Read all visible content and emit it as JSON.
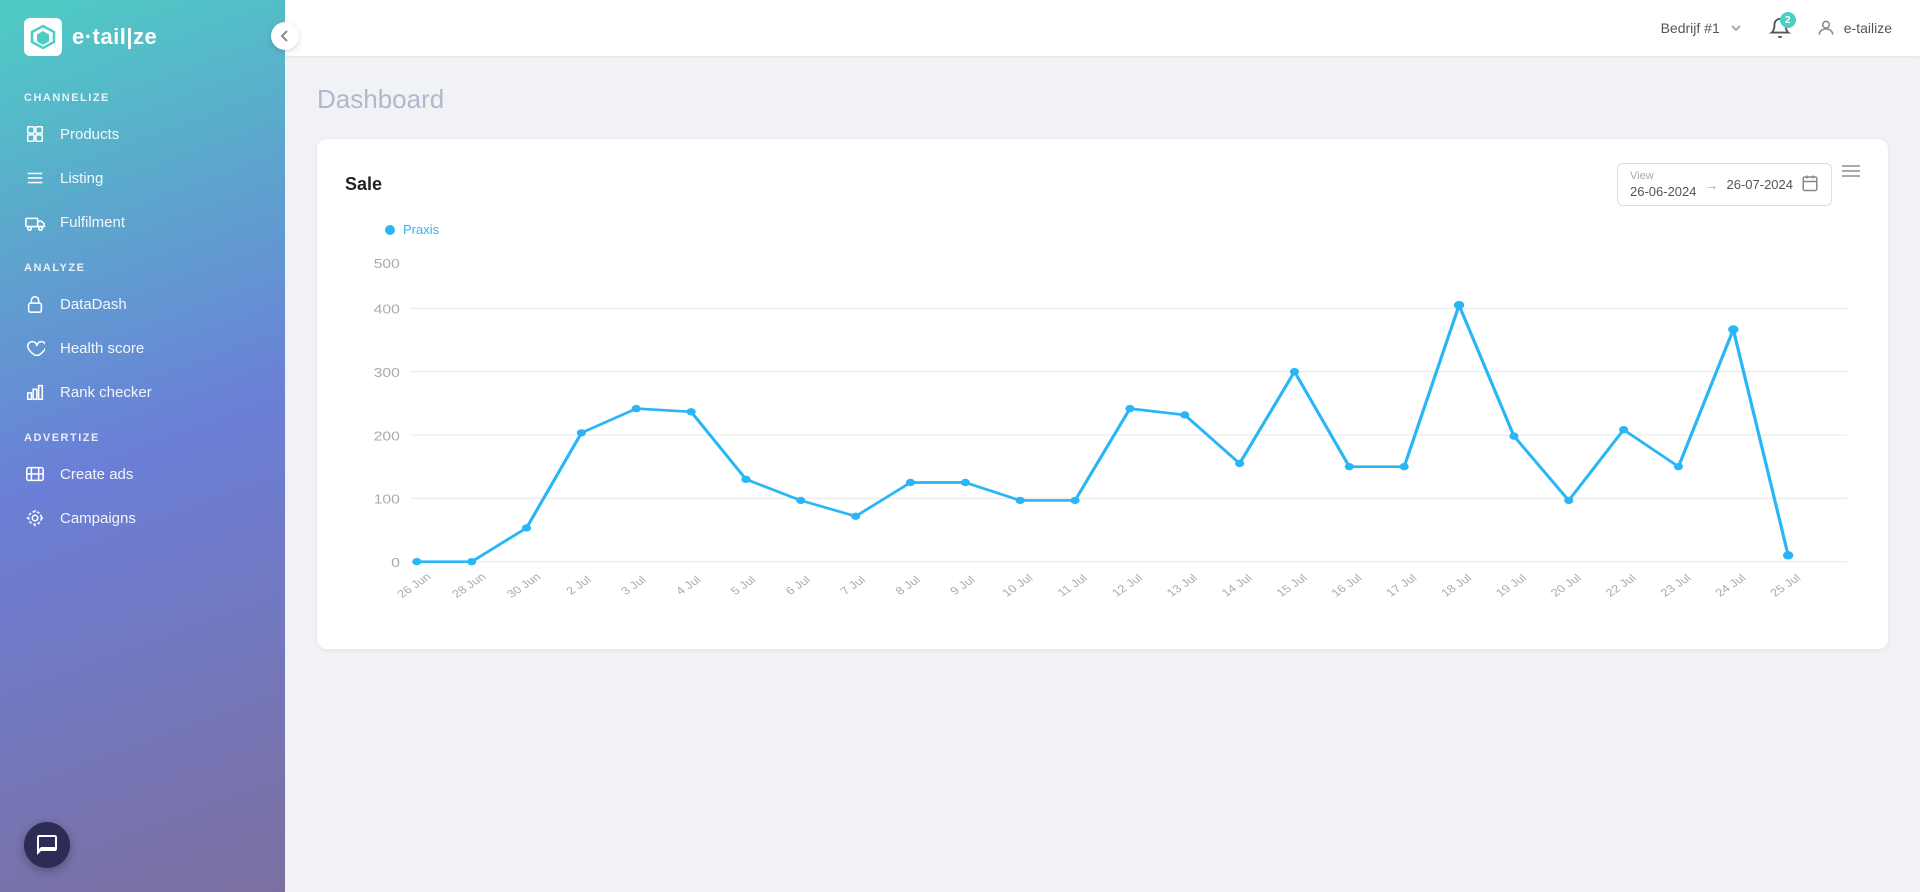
{
  "sidebar": {
    "logo_text": "e·tail|ze",
    "collapse_title": "Collapse sidebar",
    "sections": [
      {
        "label": "CHANNELIZE",
        "items": [
          {
            "id": "products",
            "label": "Products",
            "icon": "box-icon"
          },
          {
            "id": "listing",
            "label": "Listing",
            "icon": "list-icon"
          },
          {
            "id": "fulfilment",
            "label": "Fulfilment",
            "icon": "truck-icon"
          }
        ]
      },
      {
        "label": "ANALYZE",
        "items": [
          {
            "id": "datadash",
            "label": "DataDash",
            "icon": "lock-icon"
          },
          {
            "id": "health-score",
            "label": "Health score",
            "icon": "heart-icon"
          },
          {
            "id": "rank-checker",
            "label": "Rank checker",
            "icon": "bar-icon"
          }
        ]
      },
      {
        "label": "ADVERTIZE",
        "items": [
          {
            "id": "create-ads",
            "label": "Create ads",
            "icon": "ads-icon"
          },
          {
            "id": "campaigns",
            "label": "Campaigns",
            "icon": "campaigns-icon"
          }
        ]
      }
    ]
  },
  "topbar": {
    "company": "Bedrijf #1",
    "notification_count": "2",
    "user_name": "e-tailize"
  },
  "page": {
    "title": "Dashboard"
  },
  "chart": {
    "title": "Sale",
    "view_label": "View",
    "date_from": "26-06-2024",
    "date_to": "26-07-2024",
    "legend": "Praxis",
    "legend_color": "#29b6f6",
    "x_labels": [
      "26 Jun",
      "28 Jun",
      "30 Jun",
      "2 Jul",
      "3 Jul",
      "4 Jul",
      "5 Jul",
      "6 Jul",
      "7 Jul",
      "8 Jul",
      "9 Jul",
      "10 Jul",
      "11 Jul",
      "12 Jul",
      "13 Jul",
      "14 Jul",
      "15 Jul",
      "16 Jul",
      "17 Jul",
      "18 Jul",
      "19 Jul",
      "20 Jul",
      "22 Jul",
      "23 Jul",
      "24 Jul",
      "25 Jul"
    ],
    "y_labels": [
      "0",
      "100",
      "200",
      "300",
      "400",
      "500"
    ],
    "data_points": [
      0,
      0,
      55,
      210,
      250,
      245,
      135,
      100,
      75,
      130,
      130,
      100,
      100,
      250,
      240,
      160,
      310,
      155,
      155,
      420,
      205,
      100,
      215,
      155,
      380,
      10
    ]
  }
}
